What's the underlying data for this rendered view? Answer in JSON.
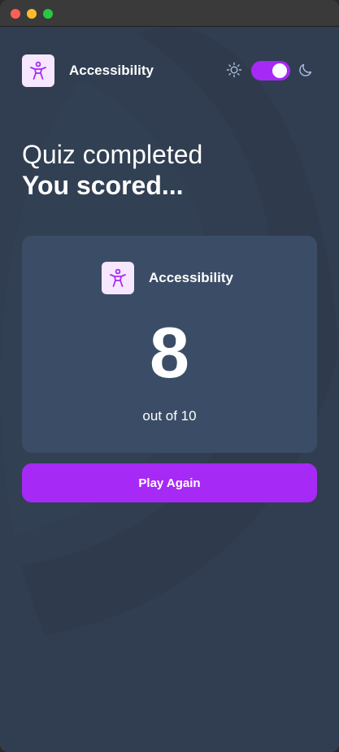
{
  "header": {
    "subject_label": "Accessibility",
    "subject_icon": "accessibility-icon",
    "theme": {
      "light_icon": "sun-icon",
      "dark_icon": "moon-icon",
      "dark_mode_on": true
    }
  },
  "result": {
    "heading_line1": "Quiz completed",
    "heading_line2": "You scored...",
    "subject_label": "Accessibility",
    "score": "8",
    "caption": "out of 10"
  },
  "actions": {
    "play_again_label": "Play Again"
  },
  "colors": {
    "background": "#313e51",
    "card": "#3b4d66",
    "accent": "#a729f5",
    "icon_bg": "#f6e7ff"
  }
}
